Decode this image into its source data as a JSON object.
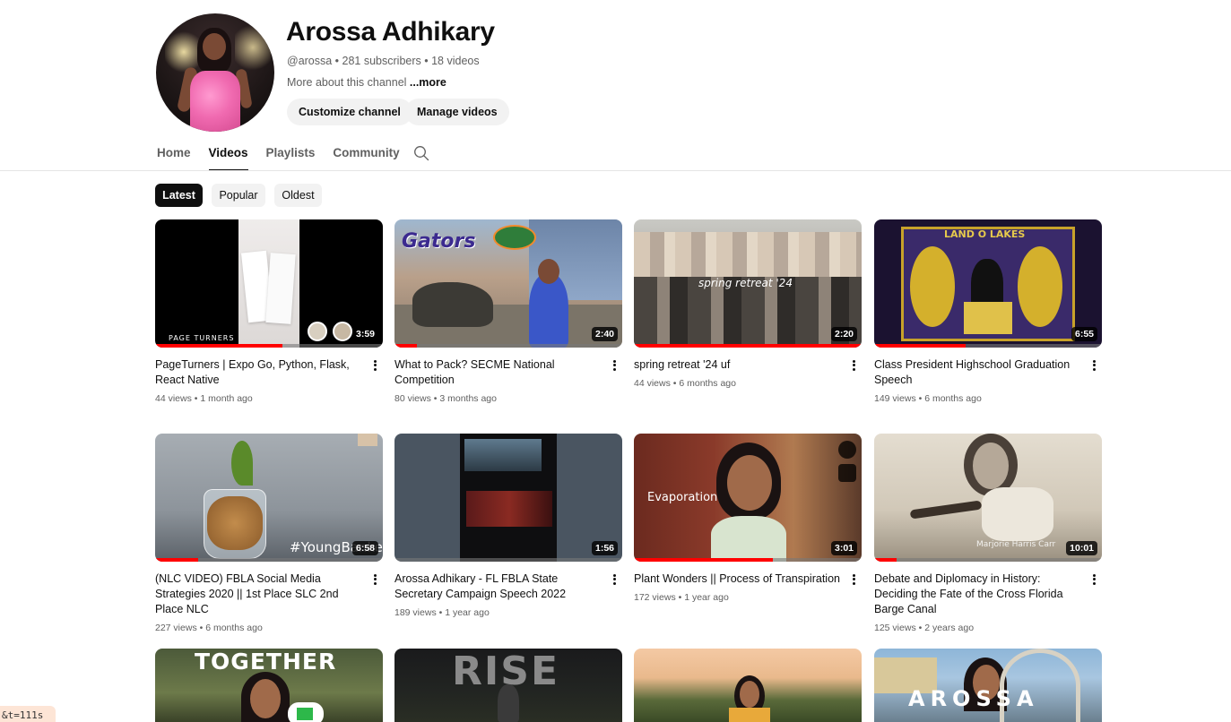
{
  "channel": {
    "name": "Arossa Adhikary",
    "meta": "@arossa • 281 subscribers • 18 videos",
    "description": "More about this channel ",
    "more_link": "...more",
    "customize_label": "Customize channel",
    "manage_label": "Manage videos"
  },
  "tabs": [
    {
      "label": "Home",
      "active": false
    },
    {
      "label": "Videos",
      "active": true
    },
    {
      "label": "Playlists",
      "active": false
    },
    {
      "label": "Community",
      "active": false
    }
  ],
  "chips": [
    {
      "label": "Latest",
      "active": true
    },
    {
      "label": "Popular",
      "active": false
    },
    {
      "label": "Oldest",
      "active": false
    }
  ],
  "videos": [
    {
      "title": "PageTurners | Expo Go, Python, Flask, React Native",
      "meta": "44 views • 1 month ago",
      "duration": "3:59",
      "progress": 0.56,
      "overlay": "PAGE TURNERS"
    },
    {
      "title": "What to Pack? SECME National Competition",
      "meta": "80 views • 3 months ago",
      "duration": "2:40",
      "progress": 0.1,
      "overlay": "Gators"
    },
    {
      "title": "spring retreat '24 uf",
      "meta": "44 views • 6 months ago",
      "duration": "2:20",
      "progress": 1.0,
      "overlay": "spring retreat '24"
    },
    {
      "title": "Class President Highschool Graduation Speech",
      "meta": "149 views • 6 months ago",
      "duration": "6:55",
      "progress": 0.4,
      "overlay": "LAND O LAKES"
    },
    {
      "title": "(NLC VIDEO) FBLA Social Media Strategies 2020 || 1st Place SLC 2nd Place NLC",
      "meta": "227 views • 6 months ago",
      "duration": "6:58",
      "progress": 0.19,
      "overlay": "#YoungBankers"
    },
    {
      "title": "Arossa Adhikary - FL FBLA State Secretary Campaign Speech 2022",
      "meta": "189 views • 1 year ago",
      "duration": "1:56",
      "progress": 0.0,
      "overlay": ""
    },
    {
      "title": "Plant Wonders || Process of Transpiration",
      "meta": "172 views • 1 year ago",
      "duration": "3:01",
      "progress": 0.61,
      "overlay": "Evaporation"
    },
    {
      "title": "Debate and Diplomacy in History: Deciding the Fate of the Cross Florida Barge Canal",
      "meta": "125 views • 2 years ago",
      "duration": "10:01",
      "progress": 0.1,
      "overlay": "Marjorie Harris Carr"
    }
  ],
  "partial_row": [
    {
      "overlay": "TOGETHER"
    },
    {
      "overlay": "RISE"
    },
    {
      "overlay": ""
    },
    {
      "overlay": "AROSSA"
    }
  ],
  "bottom_hint": "&t=111s",
  "colors": {
    "accent": "#ff0000",
    "text": "#0f0f0f",
    "secondary_text": "#606060",
    "chip_bg": "#f2f2f2"
  }
}
